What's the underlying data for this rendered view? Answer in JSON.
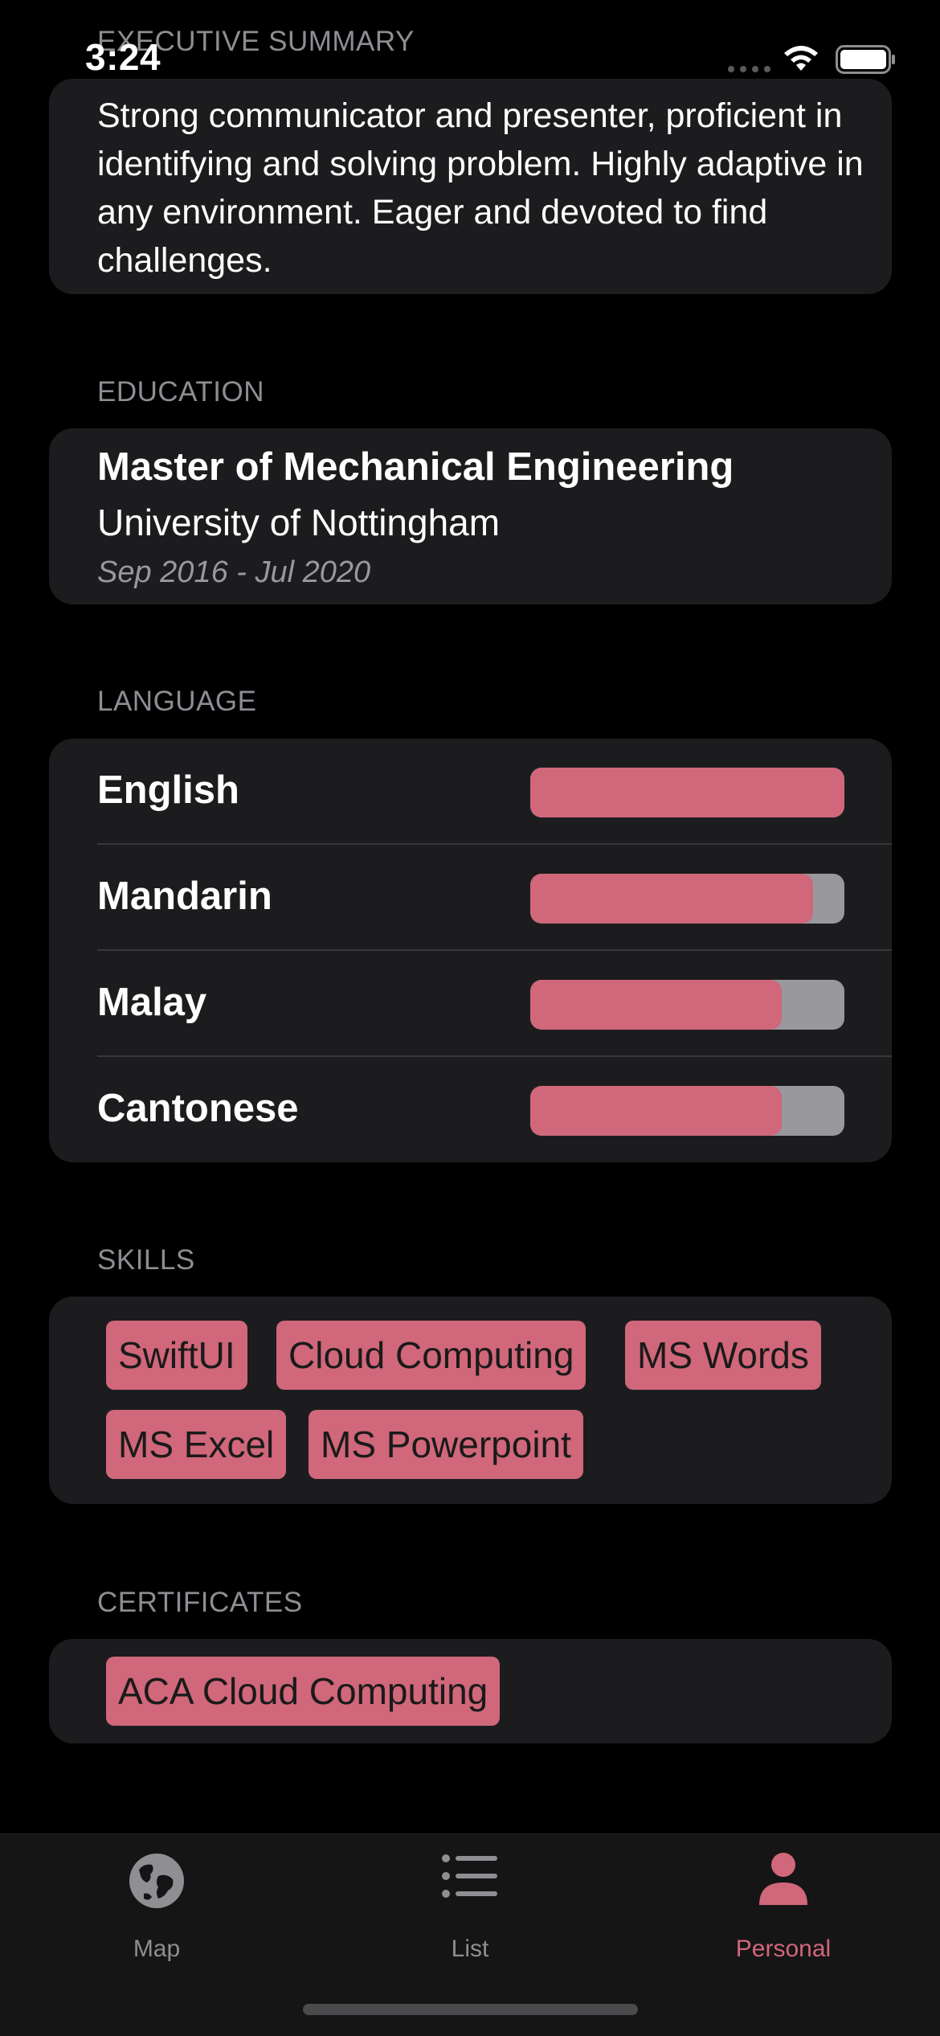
{
  "status_bar": {
    "time": "3:24"
  },
  "summary": {
    "header": "EXECUTIVE SUMMARY",
    "text": "Strong communicator and presenter, proficient in identifying and solving problem. Highly adaptive in any environment. Eager and devoted to find challenges."
  },
  "education": {
    "header": "EDUCATION",
    "degree": "Master of Mechanical Engineering",
    "university": "University of Nottingham",
    "period": "Sep 2016 - Jul 2020"
  },
  "language": {
    "header": "LANGUAGE",
    "items": [
      {
        "name": "English",
        "level": 1.0
      },
      {
        "name": "Mandarin",
        "level": 0.9
      },
      {
        "name": "Malay",
        "level": 0.8
      },
      {
        "name": "Cantonese",
        "level": 0.8
      }
    ]
  },
  "skills": {
    "header": "SKILLS",
    "items": [
      "SwiftUI",
      "Cloud Computing",
      "MS Words",
      "MS Excel",
      "MS Powerpoint"
    ]
  },
  "certificates": {
    "header": "CERTIFICATES",
    "items": [
      "ACA Cloud Computing"
    ]
  },
  "tab_bar": {
    "items": [
      {
        "label": "Map",
        "icon": "globe-icon"
      },
      {
        "label": "List",
        "icon": "list-icon"
      },
      {
        "label": "Personal",
        "icon": "person-icon",
        "active": true
      }
    ]
  },
  "colors": {
    "accent": "#d0677a",
    "background": "#000000",
    "card": "#1c1c1e",
    "track": "#98989d"
  }
}
